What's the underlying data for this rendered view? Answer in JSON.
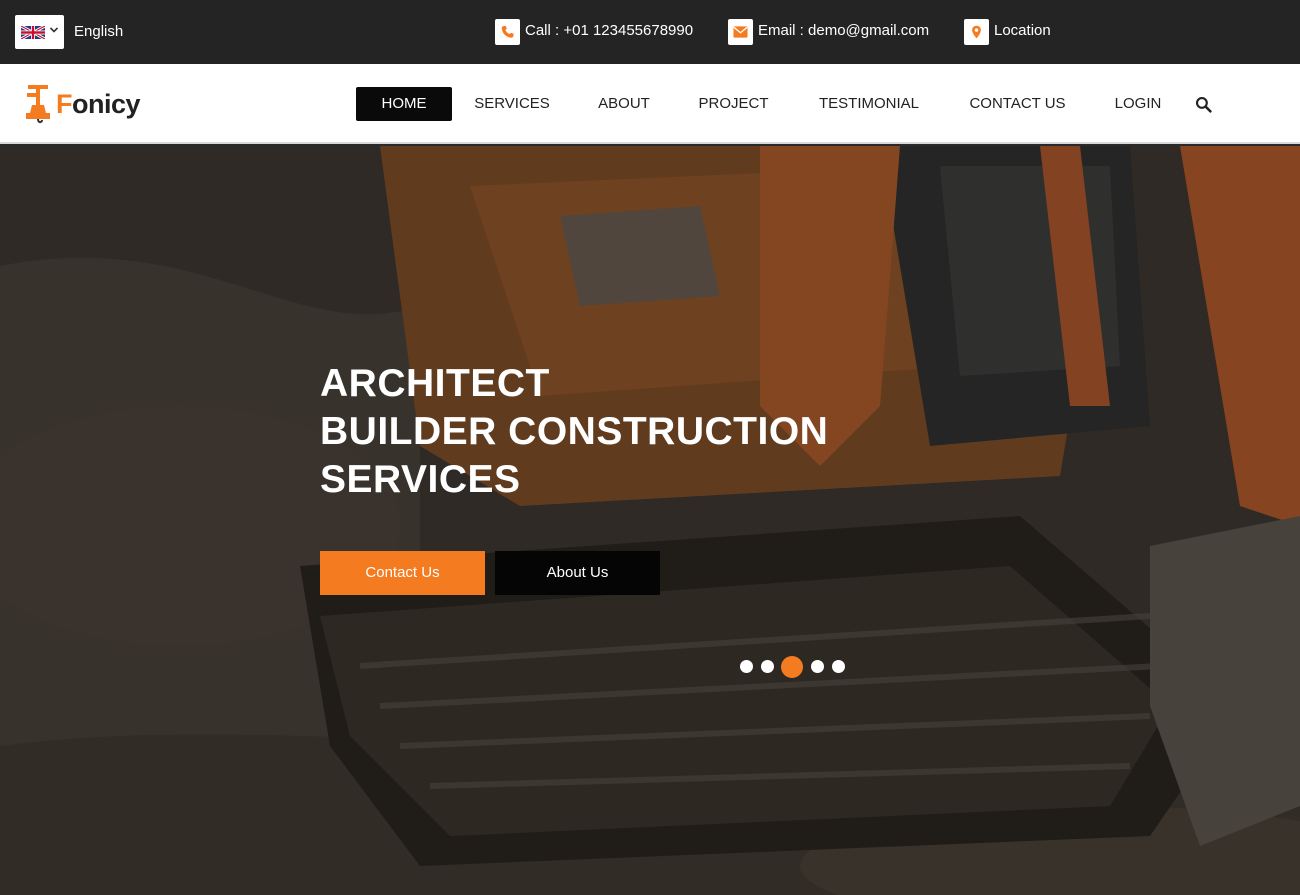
{
  "topbar": {
    "language": "English",
    "call": "Call : +01 123455678990",
    "email": "Email : demo@gmail.com",
    "location": "Location"
  },
  "brand": {
    "name_prefix": "F",
    "name_rest": "onicy",
    "accent": "#f47b20"
  },
  "nav": {
    "items": [
      {
        "label": "HOME",
        "active": true
      },
      {
        "label": "SERVICES"
      },
      {
        "label": "ABOUT"
      },
      {
        "label": "PROJECT"
      },
      {
        "label": "TESTIMONIAL"
      },
      {
        "label": "CONTACT US"
      },
      {
        "label": "LOGIN"
      }
    ]
  },
  "hero": {
    "title_lines": [
      "ARCHITECT",
      "BUILDER CONSTRUCTION",
      "SERVICES"
    ],
    "buttons": {
      "contact": "Contact Us",
      "about": "About Us"
    },
    "slides": {
      "count": 5,
      "active": 3
    }
  },
  "icons": {
    "phone": "phone-icon",
    "email": "envelope-icon",
    "location": "map-marker-icon",
    "search": "search-icon",
    "language": "uk-flag-icon",
    "dropdown": "chevron-down-icon"
  }
}
